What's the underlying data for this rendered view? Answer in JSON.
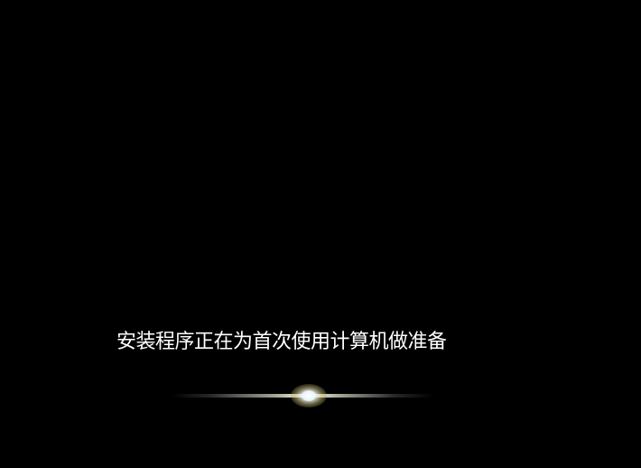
{
  "setup": {
    "status_message": "安装程序正在为首次使用计算机做准备"
  },
  "colors": {
    "background": "#000000",
    "text": "#ffffff",
    "glow": "#fffff0"
  }
}
